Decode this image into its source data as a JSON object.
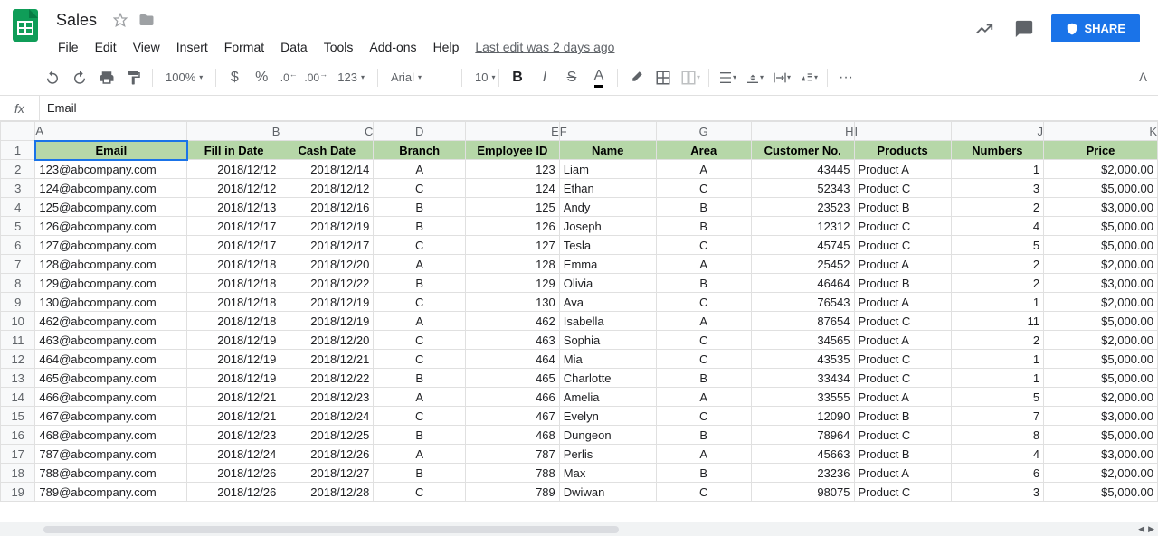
{
  "doc": {
    "title": "Sales",
    "last_edit": "Last edit was 2 days ago"
  },
  "menu": [
    "File",
    "Edit",
    "View",
    "Insert",
    "Format",
    "Data",
    "Tools",
    "Add-ons",
    "Help"
  ],
  "share": "SHARE",
  "toolbar": {
    "zoom": "100%",
    "currency": "$",
    "percent": "%",
    "dec_dec": ".0",
    "inc_dec": ".00",
    "num_fmt": "123",
    "font": "Arial",
    "size": "10",
    "bold": "B",
    "italic": "I",
    "strike": "S",
    "text_color": "A",
    "more": "···"
  },
  "formula": {
    "label": "fx",
    "value": "Email"
  },
  "columns": [
    "A",
    "B",
    "C",
    "D",
    "E",
    "F",
    "G",
    "H",
    "I",
    "J",
    "K"
  ],
  "headers": [
    "Email",
    "Fill in Date",
    "Cash Date",
    "Branch",
    "Employee ID",
    "Name",
    "Area",
    "Customer No.",
    "Products",
    "Numbers",
    "Price"
  ],
  "rows": [
    {
      "n": 2,
      "email": "123@abcompany.com",
      "fill": "2018/12/12",
      "cash": "2018/12/14",
      "branch": "A",
      "emp": "123",
      "name": "Liam",
      "area": "A",
      "cust": "43445",
      "prod": "Product A",
      "num": "1",
      "price": "$2,000.00"
    },
    {
      "n": 3,
      "email": "124@abcompany.com",
      "fill": "2018/12/12",
      "cash": "2018/12/12",
      "branch": "C",
      "emp": "124",
      "name": "Ethan",
      "area": "C",
      "cust": "52343",
      "prod": "Product C",
      "num": "3",
      "price": "$5,000.00"
    },
    {
      "n": 4,
      "email": "125@abcompany.com",
      "fill": "2018/12/13",
      "cash": "2018/12/16",
      "branch": "B",
      "emp": "125",
      "name": "Andy",
      "area": "B",
      "cust": "23523",
      "prod": "Product B",
      "num": "2",
      "price": "$3,000.00"
    },
    {
      "n": 5,
      "email": "126@abcompany.com",
      "fill": "2018/12/17",
      "cash": "2018/12/19",
      "branch": "B",
      "emp": "126",
      "name": "Joseph",
      "area": "B",
      "cust": "12312",
      "prod": "Product C",
      "num": "4",
      "price": "$5,000.00"
    },
    {
      "n": 6,
      "email": "127@abcompany.com",
      "fill": "2018/12/17",
      "cash": "2018/12/17",
      "branch": "C",
      "emp": "127",
      "name": "Tesla",
      "area": "C",
      "cust": "45745",
      "prod": "Product C",
      "num": "5",
      "price": "$5,000.00"
    },
    {
      "n": 7,
      "email": "128@abcompany.com",
      "fill": "2018/12/18",
      "cash": "2018/12/20",
      "branch": "A",
      "emp": "128",
      "name": "Emma",
      "area": "A",
      "cust": "25452",
      "prod": "Product A",
      "num": "2",
      "price": "$2,000.00"
    },
    {
      "n": 8,
      "email": "129@abcompany.com",
      "fill": "2018/12/18",
      "cash": "2018/12/22",
      "branch": "B",
      "emp": "129",
      "name": "Olivia",
      "area": "B",
      "cust": "46464",
      "prod": "Product B",
      "num": "2",
      "price": "$3,000.00"
    },
    {
      "n": 9,
      "email": "130@abcompany.com",
      "fill": "2018/12/18",
      "cash": "2018/12/19",
      "branch": "C",
      "emp": "130",
      "name": "Ava",
      "area": "C",
      "cust": "76543",
      "prod": "Product A",
      "num": "1",
      "price": "$2,000.00"
    },
    {
      "n": 10,
      "email": "462@abcompany.com",
      "fill": "2018/12/18",
      "cash": "2018/12/19",
      "branch": "A",
      "emp": "462",
      "name": "Isabella",
      "area": "A",
      "cust": "87654",
      "prod": "Product C",
      "num": "11",
      "price": "$5,000.00"
    },
    {
      "n": 11,
      "email": "463@abcompany.com",
      "fill": "2018/12/19",
      "cash": "2018/12/20",
      "branch": "C",
      "emp": "463",
      "name": "Sophia",
      "area": "C",
      "cust": "34565",
      "prod": "Product A",
      "num": "2",
      "price": "$2,000.00"
    },
    {
      "n": 12,
      "email": "464@abcompany.com",
      "fill": "2018/12/19",
      "cash": "2018/12/21",
      "branch": "C",
      "emp": "464",
      "name": "Mia",
      "area": "C",
      "cust": "43535",
      "prod": "Product C",
      "num": "1",
      "price": "$5,000.00"
    },
    {
      "n": 13,
      "email": "465@abcompany.com",
      "fill": "2018/12/19",
      "cash": "2018/12/22",
      "branch": "B",
      "emp": "465",
      "name": "Charlotte",
      "area": "B",
      "cust": "33434",
      "prod": "Product C",
      "num": "1",
      "price": "$5,000.00"
    },
    {
      "n": 14,
      "email": "466@abcompany.com",
      "fill": "2018/12/21",
      "cash": "2018/12/23",
      "branch": "A",
      "emp": "466",
      "name": "Amelia",
      "area": "A",
      "cust": "33555",
      "prod": "Product A",
      "num": "5",
      "price": "$2,000.00"
    },
    {
      "n": 15,
      "email": "467@abcompany.com",
      "fill": "2018/12/21",
      "cash": "2018/12/24",
      "branch": "C",
      "emp": "467",
      "name": "Evelyn",
      "area": "C",
      "cust": "12090",
      "prod": "Product B",
      "num": "7",
      "price": "$3,000.00"
    },
    {
      "n": 16,
      "email": "468@abcompany.com",
      "fill": "2018/12/23",
      "cash": "2018/12/25",
      "branch": "B",
      "emp": "468",
      "name": "Dungeon",
      "area": "B",
      "cust": "78964",
      "prod": "Product C",
      "num": "8",
      "price": "$5,000.00"
    },
    {
      "n": 17,
      "email": "787@abcompany.com",
      "fill": "2018/12/24",
      "cash": "2018/12/26",
      "branch": "A",
      "emp": "787",
      "name": "Perlis",
      "area": "A",
      "cust": "45663",
      "prod": "Product B",
      "num": "4",
      "price": "$3,000.00"
    },
    {
      "n": 18,
      "email": "788@abcompany.com",
      "fill": "2018/12/26",
      "cash": "2018/12/27",
      "branch": "B",
      "emp": "788",
      "name": "Max",
      "area": "B",
      "cust": "23236",
      "prod": "Product A",
      "num": "6",
      "price": "$2,000.00"
    },
    {
      "n": 19,
      "email": "789@abcompany.com",
      "fill": "2018/12/26",
      "cash": "2018/12/28",
      "branch": "C",
      "emp": "789",
      "name": "Dwiwan",
      "area": "C",
      "cust": "98075",
      "prod": "Product C",
      "num": "3",
      "price": "$5,000.00"
    }
  ]
}
